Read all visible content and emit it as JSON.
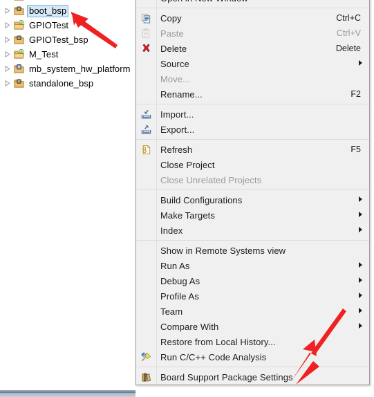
{
  "explorer": {
    "name": "project-explorer",
    "items": [
      {
        "label": "",
        "icon": "bsp-project-icon",
        "selected": false,
        "partial": true
      },
      {
        "label": "boot_bsp",
        "icon": "bsp-project-icon",
        "selected": true,
        "partial": false
      },
      {
        "label": "GPIOTest",
        "icon": "c-project-icon",
        "selected": false,
        "partial": false
      },
      {
        "label": "GPIOTest_bsp",
        "icon": "bsp-project-icon",
        "selected": false,
        "partial": false
      },
      {
        "label": "M_Test",
        "icon": "c-project-icon",
        "selected": false,
        "partial": false
      },
      {
        "label": "mb_system_hw_platform",
        "icon": "hw-platform-icon",
        "selected": false,
        "partial": false
      },
      {
        "label": "standalone_bsp",
        "icon": "bsp-project-icon",
        "selected": false,
        "partial": false
      }
    ],
    "selection_fill": "#d6e9f8",
    "selection_border": "#7aaed6"
  },
  "context_menu": {
    "name": "project-context-menu",
    "background": "#f0f0f0",
    "border": "#9e9e9e",
    "groups": [
      {
        "items": [
          {
            "label": "Open in New Window",
            "accel": "",
            "icon": "",
            "disabled": false,
            "submenu": false,
            "partial": true
          }
        ]
      },
      {
        "items": [
          {
            "label": "Copy",
            "accel": "Ctrl+C",
            "icon": "copy-icon",
            "disabled": false,
            "submenu": false
          },
          {
            "label": "Paste",
            "accel": "Ctrl+V",
            "icon": "paste-icon",
            "disabled": true,
            "submenu": false
          },
          {
            "label": "Delete",
            "accel": "Delete",
            "icon": "delete-icon",
            "disabled": false,
            "submenu": false
          },
          {
            "label": "Source",
            "accel": "",
            "icon": "",
            "disabled": false,
            "submenu": true
          },
          {
            "label": "Move...",
            "accel": "",
            "icon": "",
            "disabled": true,
            "submenu": false
          },
          {
            "label": "Rename...",
            "accel": "F2",
            "icon": "",
            "disabled": false,
            "submenu": false
          }
        ]
      },
      {
        "items": [
          {
            "label": "Import...",
            "accel": "",
            "icon": "import-icon",
            "disabled": false,
            "submenu": false
          },
          {
            "label": "Export...",
            "accel": "",
            "icon": "export-icon",
            "disabled": false,
            "submenu": false
          }
        ]
      },
      {
        "items": [
          {
            "label": "Refresh",
            "accel": "F5",
            "icon": "refresh-icon",
            "disabled": false,
            "submenu": false
          },
          {
            "label": "Close Project",
            "accel": "",
            "icon": "",
            "disabled": false,
            "submenu": false
          },
          {
            "label": "Close Unrelated Projects",
            "accel": "",
            "icon": "",
            "disabled": true,
            "submenu": false
          }
        ]
      },
      {
        "items": [
          {
            "label": "Build Configurations",
            "accel": "",
            "icon": "",
            "disabled": false,
            "submenu": true
          },
          {
            "label": "Make Targets",
            "accel": "",
            "icon": "",
            "disabled": false,
            "submenu": true
          },
          {
            "label": "Index",
            "accel": "",
            "icon": "",
            "disabled": false,
            "submenu": true
          }
        ]
      },
      {
        "items": [
          {
            "label": "Show in Remote Systems view",
            "accel": "",
            "icon": "",
            "disabled": false,
            "submenu": false
          },
          {
            "label": "Run As",
            "accel": "",
            "icon": "",
            "disabled": false,
            "submenu": true
          },
          {
            "label": "Debug As",
            "accel": "",
            "icon": "",
            "disabled": false,
            "submenu": true
          },
          {
            "label": "Profile As",
            "accel": "",
            "icon": "",
            "disabled": false,
            "submenu": true
          },
          {
            "label": "Team",
            "accel": "",
            "icon": "",
            "disabled": false,
            "submenu": true
          },
          {
            "label": "Compare With",
            "accel": "",
            "icon": "",
            "disabled": false,
            "submenu": true
          },
          {
            "label": "Restore from Local History...",
            "accel": "",
            "icon": "",
            "disabled": false,
            "submenu": false
          },
          {
            "label": "Run C/C++ Code Analysis",
            "accel": "",
            "icon": "code-analysis-icon",
            "disabled": false,
            "submenu": false
          }
        ]
      },
      {
        "items": [
          {
            "label": "Board Support Package Settings",
            "accel": "",
            "icon": "bsp-settings-icon",
            "disabled": false,
            "submenu": false
          }
        ]
      }
    ]
  },
  "annotations": {
    "color": "#ee2222",
    "arrows": [
      {
        "name": "arrow-to-boot-bsp",
        "target": "boot_bsp"
      },
      {
        "name": "arrow-to-bsp-settings",
        "target": "Board Support Package Settings"
      }
    ]
  }
}
